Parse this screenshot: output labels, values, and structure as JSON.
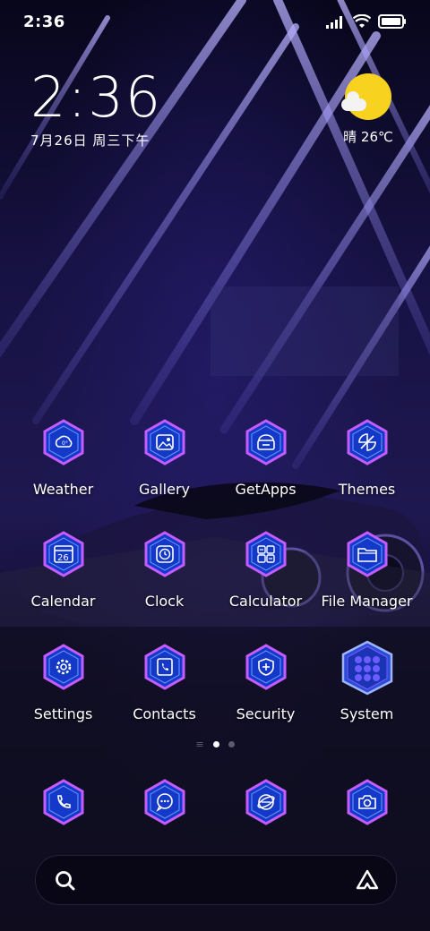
{
  "status_bar": {
    "time": "2:36",
    "icons": [
      "signal-icon",
      "wifi-icon",
      "battery-icon"
    ]
  },
  "clock_widget": {
    "time": "2:36",
    "date": "7月26日 周三下午"
  },
  "weather_widget": {
    "icon": "sun-cloud-icon",
    "text": "晴 26℃"
  },
  "apps": [
    {
      "label": "Weather",
      "icon": "weather-icon"
    },
    {
      "label": "Gallery",
      "icon": "gallery-icon"
    },
    {
      "label": "GetApps",
      "icon": "getapps-icon"
    },
    {
      "label": "Themes",
      "icon": "themes-icon"
    },
    {
      "label": "Calendar",
      "icon": "calendar-icon"
    },
    {
      "label": "Clock",
      "icon": "clock-icon"
    },
    {
      "label": "Calculator",
      "icon": "calculator-icon"
    },
    {
      "label": "File Manager",
      "icon": "folder-icon"
    },
    {
      "label": "Settings",
      "icon": "gear-icon"
    },
    {
      "label": "Contacts",
      "icon": "contacts-icon"
    },
    {
      "label": "Security",
      "icon": "shield-plus-icon"
    },
    {
      "label": "System",
      "icon": "folder-grid-icon"
    }
  ],
  "page_indicator": {
    "pages": 2,
    "current": 1
  },
  "dock": [
    {
      "icon": "phone-icon"
    },
    {
      "icon": "messages-icon"
    },
    {
      "icon": "browser-icon"
    },
    {
      "icon": "camera-icon"
    }
  ],
  "calendar_day": "26",
  "search_bar": {
    "left_icon": "search-icon",
    "right_icon": "assistant-icon"
  },
  "colors": {
    "accent": "#3d6bff",
    "hex_glow": "#b14cff",
    "sun": "#f7d31f"
  }
}
